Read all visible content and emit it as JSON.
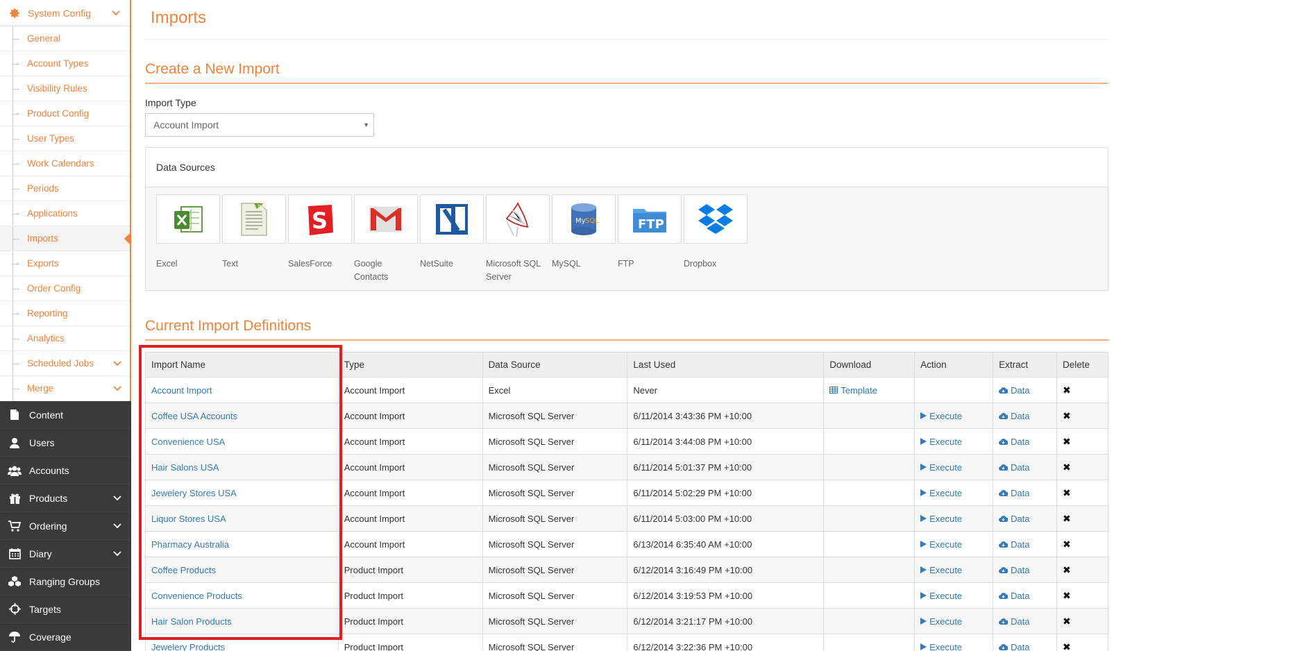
{
  "sidebar": {
    "system_config": {
      "label": "System Config",
      "items": [
        {
          "label": "General"
        },
        {
          "label": "Account Types"
        },
        {
          "label": "Visibility Rules"
        },
        {
          "label": "Product Config"
        },
        {
          "label": "User Types"
        },
        {
          "label": "Work Calendars"
        },
        {
          "label": "Periods"
        },
        {
          "label": "Applications"
        },
        {
          "label": "Imports"
        },
        {
          "label": "Exports"
        },
        {
          "label": "Order Config"
        },
        {
          "label": "Reporting"
        },
        {
          "label": "Analytics"
        },
        {
          "label": "Scheduled Jobs"
        },
        {
          "label": "Merge"
        }
      ]
    },
    "nav": [
      {
        "label": "Content"
      },
      {
        "label": "Users"
      },
      {
        "label": "Accounts"
      },
      {
        "label": "Products"
      },
      {
        "label": "Ordering"
      },
      {
        "label": "Diary"
      },
      {
        "label": "Ranging Groups"
      },
      {
        "label": "Targets"
      },
      {
        "label": "Coverage"
      }
    ]
  },
  "page": {
    "title": "Imports",
    "new_import": {
      "section_title": "Create a New Import",
      "import_type_label": "Import Type",
      "import_type_value": "Account Import"
    },
    "data_sources": {
      "heading": "Data Sources",
      "tiles": [
        {
          "label": "Excel"
        },
        {
          "label": "Text"
        },
        {
          "label": "SalesForce"
        },
        {
          "label": "Google Contacts"
        },
        {
          "label": "NetSuite"
        },
        {
          "label": "Microsoft SQL Server"
        },
        {
          "label": "MySQL"
        },
        {
          "label": "FTP"
        },
        {
          "label": "Dropbox"
        }
      ]
    },
    "definitions": {
      "section_title": "Current Import Definitions",
      "columns": [
        "Import Name",
        "Type",
        "Data Source",
        "Last Used",
        "Download",
        "Action",
        "Extract",
        "Delete"
      ],
      "rows": [
        {
          "name": "Account Import",
          "type": "Account Import",
          "source": "Excel",
          "last_used": "Never",
          "download": "Template",
          "action": "",
          "extract": "Data"
        },
        {
          "name": "Coffee USA Accounts",
          "type": "Account Import",
          "source": "Microsoft SQL Server",
          "last_used": "6/11/2014 3:43:36 PM +10:00",
          "download": "",
          "action": "Execute",
          "extract": "Data"
        },
        {
          "name": "Convenience USA",
          "type": "Account Import",
          "source": "Microsoft SQL Server",
          "last_used": "6/11/2014 3:44:08 PM +10:00",
          "download": "",
          "action": "Execute",
          "extract": "Data"
        },
        {
          "name": "Hair Salons USA",
          "type": "Account Import",
          "source": "Microsoft SQL Server",
          "last_used": "6/11/2014 5:01:37 PM +10:00",
          "download": "",
          "action": "Execute",
          "extract": "Data"
        },
        {
          "name": "Jewelery Stores USA",
          "type": "Account Import",
          "source": "Microsoft SQL Server",
          "last_used": "6/11/2014 5:02:29 PM +10:00",
          "download": "",
          "action": "Execute",
          "extract": "Data"
        },
        {
          "name": "Liquor Stores USA",
          "type": "Account Import",
          "source": "Microsoft SQL Server",
          "last_used": "6/11/2014 5:03:00 PM +10:00",
          "download": "",
          "action": "Execute",
          "extract": "Data"
        },
        {
          "name": "Pharmacy Australia",
          "type": "Account Import",
          "source": "Microsoft SQL Server",
          "last_used": "6/13/2014 6:35:40 AM +10:00",
          "download": "",
          "action": "Execute",
          "extract": "Data"
        },
        {
          "name": "Coffee Products",
          "type": "Product Import",
          "source": "Microsoft SQL Server",
          "last_used": "6/12/2014 3:16:49 PM +10:00",
          "download": "",
          "action": "Execute",
          "extract": "Data"
        },
        {
          "name": "Convenience Products",
          "type": "Product Import",
          "source": "Microsoft SQL Server",
          "last_used": "6/12/2014 3:19:53 PM +10:00",
          "download": "",
          "action": "Execute",
          "extract": "Data"
        },
        {
          "name": "Hair Salon Products",
          "type": "Product Import",
          "source": "Microsoft SQL Server",
          "last_used": "6/12/2014 3:21:17 PM +10:00",
          "download": "",
          "action": "Execute",
          "extract": "Data"
        },
        {
          "name": "Jewelery Products",
          "type": "Product Import",
          "source": "Microsoft SQL Server",
          "last_used": "6/12/2014 3:22:36 PM +10:00",
          "download": "",
          "action": "Execute",
          "extract": "Data"
        }
      ]
    }
  },
  "colors": {
    "accent": "#f0843c",
    "link": "#337ab7",
    "sidebar_dark": "#3a3a3a",
    "highlight": "#e02020"
  }
}
